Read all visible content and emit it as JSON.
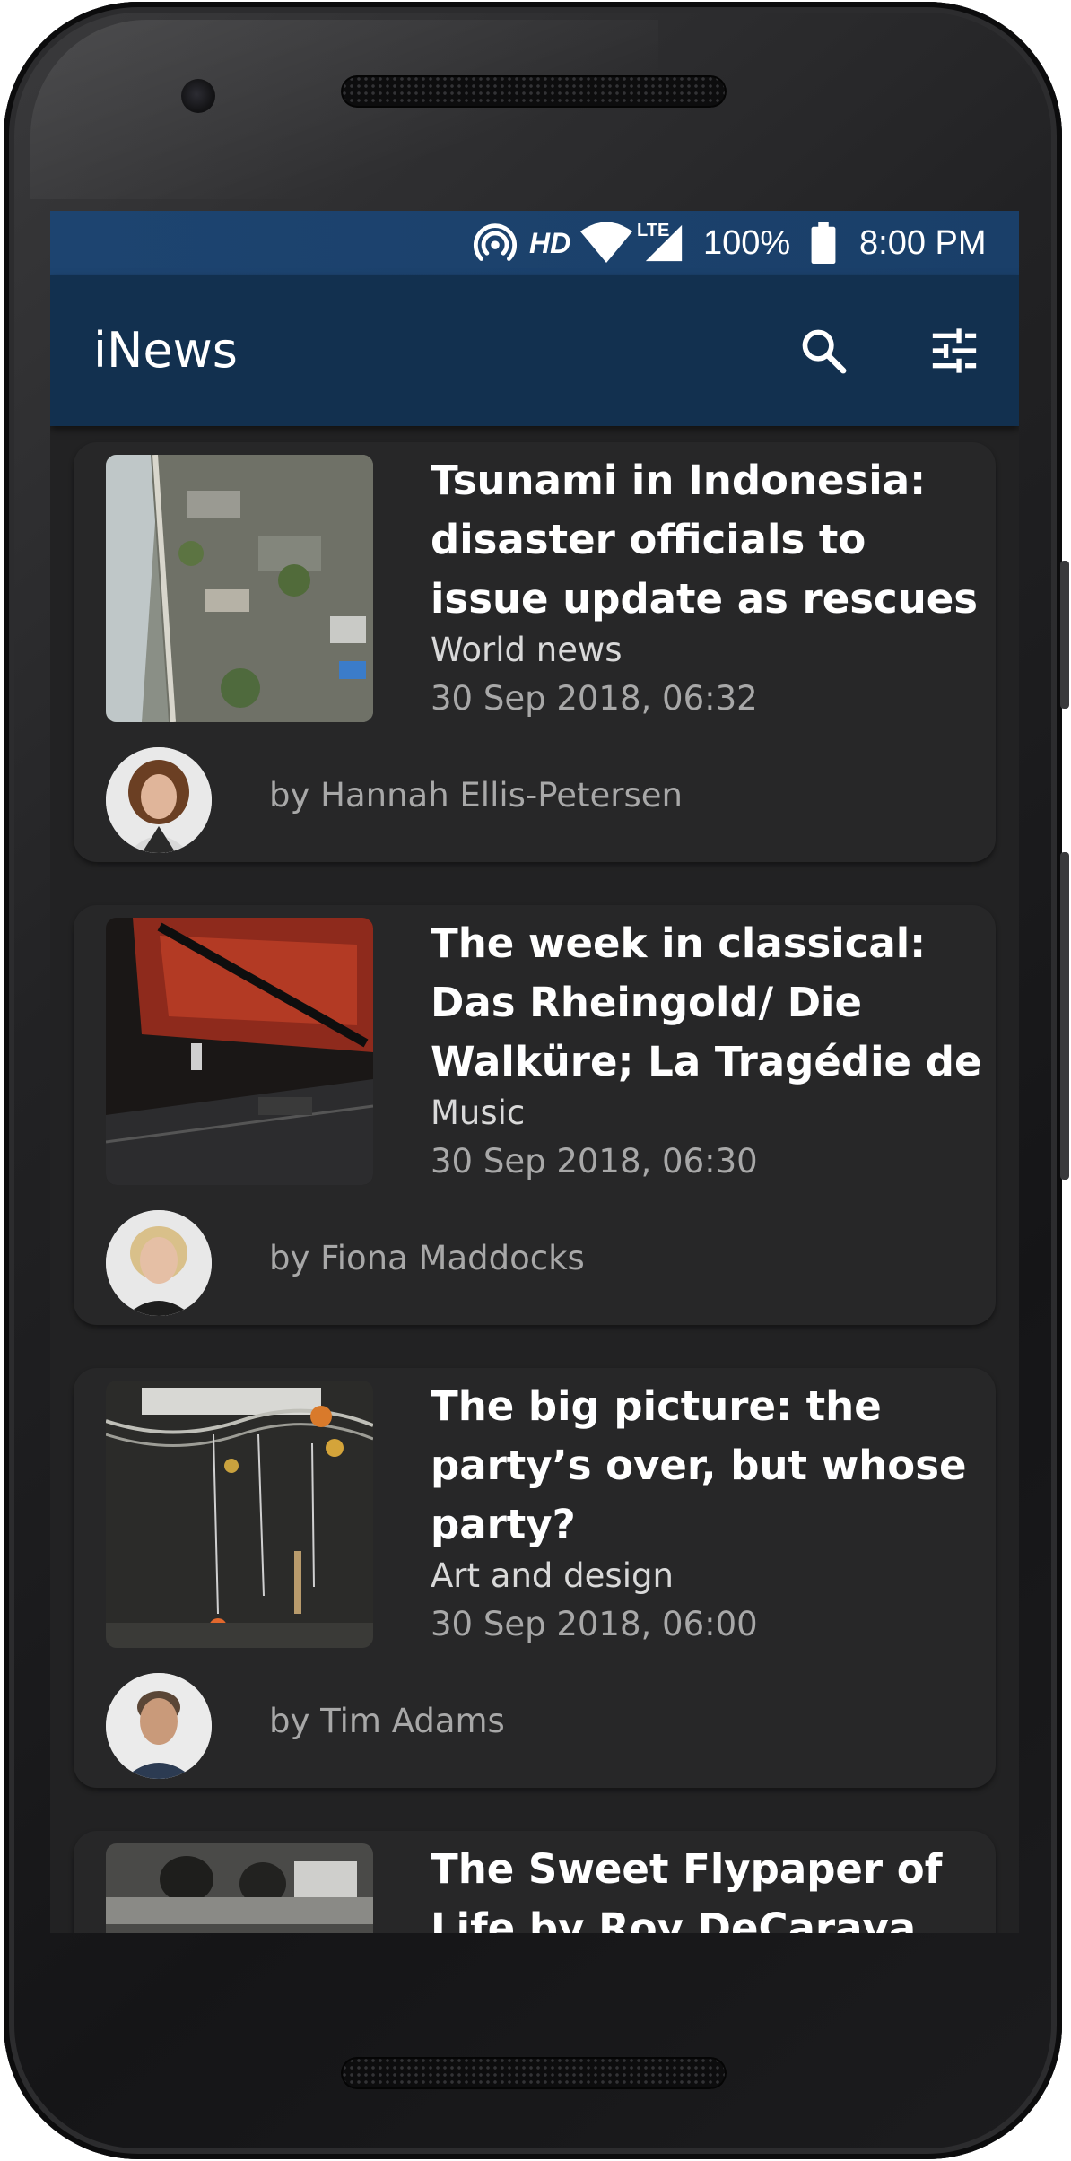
{
  "status_bar": {
    "hd_label": "HD",
    "lte_label": "LTE",
    "battery_text": "100%",
    "time": "8:00 PM",
    "icons": [
      "hotspot-icon",
      "wifi-icon",
      "signal-icon",
      "battery-icon"
    ]
  },
  "app_bar": {
    "title": "iNews",
    "actions": [
      "search-icon",
      "filter-sliders-icon"
    ]
  },
  "colors": {
    "status_bar": "#1d4470",
    "app_bar": "#12304f",
    "background": "#222223",
    "card": "#272728",
    "headline": "#ffffff",
    "meta": "#a8a8a8"
  },
  "articles": [
    {
      "headline": "Tsunami in Indonesia: disaster officials to issue update as rescues",
      "section": "World news",
      "date": "30 Sep 2018, 06:32",
      "byline": "by Hannah Ellis-Petersen"
    },
    {
      "headline": "The week in classical: Das Rheingold/ Die Walküre; La Tragédie de Carmen –",
      "section": "Music",
      "date": "30 Sep 2018, 06:30",
      "byline": "by Fiona Maddocks"
    },
    {
      "headline": "The big picture: the party’s over, but whose party?",
      "section": "Art and design",
      "date": "30 Sep 2018, 06:00",
      "byline": "by Tim Adams"
    },
    {
      "headline": "The Sweet Flypaper of Life by Roy DeCarava and"
    }
  ]
}
